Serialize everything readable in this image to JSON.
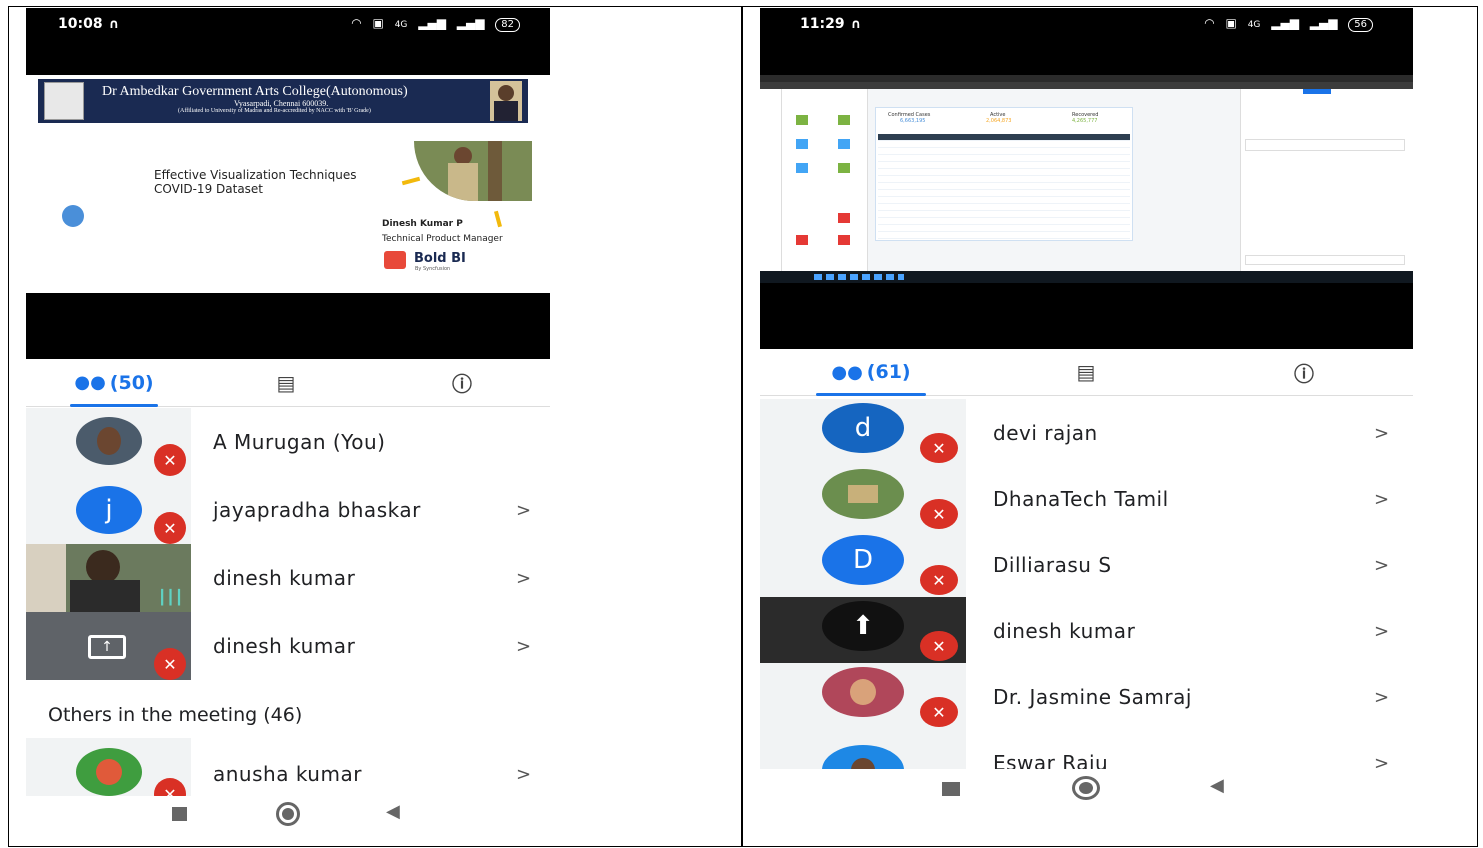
{
  "left": {
    "status": {
      "time": "10:08",
      "battery": "82",
      "network": "4G"
    },
    "slide": {
      "college_name": "Dr Ambedkar Government Arts College(Autonomous)",
      "college_address": "Vyasarpadi, Chennai 600039.",
      "college_affiliation": "(Affiliated to University of Madras and Re-accredited by NACC with 'B' Grade)",
      "talk_title_line1": "Effective Visualization Techniques",
      "talk_title_line2": "COVID-19 Dataset",
      "speaker_name": "Dinesh Kumar P",
      "speaker_role": "Technical Product Manager",
      "brand_name": "Bold BI",
      "brand_sub": "By Syncfusion"
    },
    "tabs": {
      "people_count": "(50)"
    },
    "participants": [
      {
        "name": "A Murugan (You)",
        "chevron": ""
      },
      {
        "name": "jayapradha bhaskar",
        "initial": "j",
        "chevron": ">"
      },
      {
        "name": "dinesh kumar",
        "chevron": ">"
      },
      {
        "name": "dinesh kumar",
        "chevron": ">"
      }
    ],
    "others_title": "Others in the meeting (46)",
    "others": [
      {
        "name": "anusha kumar",
        "chevron": ">"
      }
    ]
  },
  "right": {
    "status": {
      "time": "11:29",
      "battery": "56",
      "network": "4G"
    },
    "dashboard": {
      "kpi1_label": "Confirmed Cases",
      "kpi1_value": "6,663,195",
      "kpi2_label": "Active",
      "kpi2_value": "2,064,873",
      "kpi3_label": "Recovered",
      "kpi3_value": "4,265,777",
      "table_headers": [
        "Country Region",
        "Province_State",
        "Sum of Confirmed",
        "Sum of Deaths",
        "Sum of Recovered"
      ]
    },
    "tabs": {
      "people_count": "(61)"
    },
    "participants": [
      {
        "name": "devi rajan",
        "initial": "d",
        "chevron": ">"
      },
      {
        "name": "DhanaTech Tamil",
        "chevron": ">"
      },
      {
        "name": "Dilliarasu S",
        "initial": "D",
        "chevron": ">"
      },
      {
        "name": "dinesh kumar",
        "chevron": ">"
      },
      {
        "name": "Dr. Jasmine Samraj",
        "chevron": ">"
      },
      {
        "name": "Eswar Raju",
        "chevron": ">"
      }
    ]
  },
  "colors": {
    "accent": "#1a73e8",
    "mic_off": "#d93025",
    "avatar_blue": "#1565c0"
  }
}
